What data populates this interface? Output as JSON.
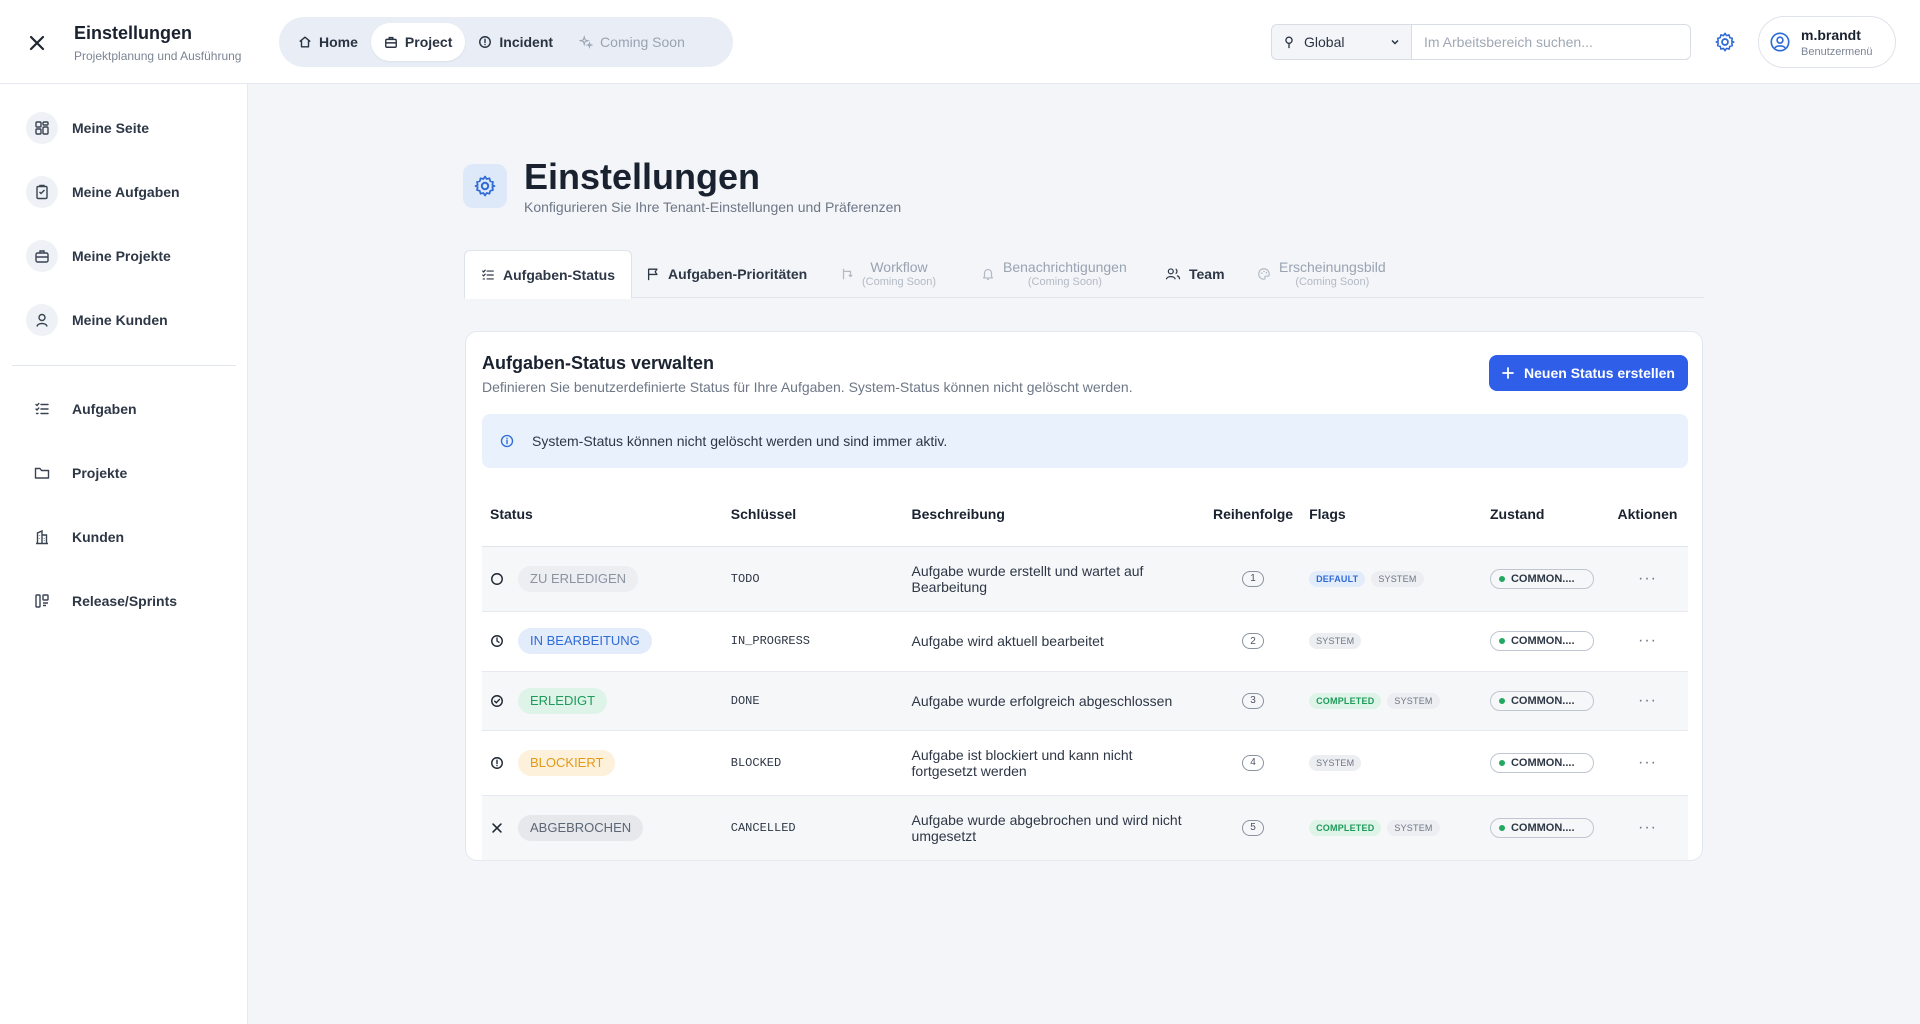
{
  "header": {
    "title": "Einstellungen",
    "subtitle": "Projektplanung und Ausführung",
    "nav": [
      {
        "label": "Home",
        "icon": "home-icon"
      },
      {
        "label": "Project",
        "icon": "briefcase-icon",
        "active": true
      },
      {
        "label": "Incident",
        "icon": "alert-circle-icon"
      },
      {
        "label": "Coming Soon",
        "icon": "sparkles-icon",
        "disabled": true
      }
    ],
    "scope_label": "Global",
    "search_placeholder": "Im Arbeitsbereich suchen...",
    "user_name": "m.brandt",
    "user_sub": "Benutzermenü"
  },
  "sidebar": {
    "items": [
      {
        "label": "Meine Seite",
        "icon": "dashboard-icon"
      },
      {
        "label": "Meine Aufgaben",
        "icon": "clipboard-icon"
      },
      {
        "label": "Meine Projekte",
        "icon": "briefcase-icon"
      },
      {
        "label": "Meine Kunden",
        "icon": "user-icon"
      },
      {
        "label": "Aufgaben",
        "icon": "list-check-icon"
      },
      {
        "label": "Projekte",
        "icon": "folder-icon"
      },
      {
        "label": "Kunden",
        "icon": "building-icon"
      },
      {
        "label": "Release/Sprints",
        "icon": "kanban-icon"
      }
    ]
  },
  "page": {
    "title": "Einstellungen",
    "subtitle": "Konfigurieren Sie Ihre Tenant-Einstellungen und Präferenzen"
  },
  "tabs": [
    {
      "label": "Aufgaben-Status",
      "active": true
    },
    {
      "label": "Aufgaben-Prioritäten"
    },
    {
      "label": "Workflow",
      "soon": "(Coming Soon)"
    },
    {
      "label": "Benachrichtigungen",
      "soon": "(Coming Soon)"
    },
    {
      "label": "Team"
    },
    {
      "label": "Erscheinungsbild",
      "soon": "(Coming Soon)"
    }
  ],
  "card": {
    "title": "Aufgaben-Status verwalten",
    "subtitle": "Definieren Sie benutzerdefinierte Status für Ihre Aufgaben. System-Status können nicht gelöscht werden.",
    "create_button": "Neuen Status erstellen",
    "info": "System-Status können nicht gelöscht werden und sind immer aktiv."
  },
  "table": {
    "headers": [
      "Status",
      "Schlüssel",
      "Beschreibung",
      "Reihenfolge",
      "Flags",
      "Zustand",
      "Aktionen"
    ],
    "rows": [
      {
        "status": "ZU ERLEDIGEN",
        "key": "TODO",
        "description": "Aufgabe wurde erstellt und wartet auf Bearbeitung",
        "order": "1",
        "flag1": "DEFAULT",
        "flag2": "SYSTEM",
        "state": "COMMON...."
      },
      {
        "status": "IN BEARBEITUNG",
        "key": "IN_PROGRESS",
        "description": "Aufgabe wird aktuell bearbeitet",
        "order": "2",
        "flag1": "SYSTEM",
        "state": "COMMON...."
      },
      {
        "status": "ERLEDIGT",
        "key": "DONE",
        "description": "Aufgabe wurde erfolgreich abgeschlossen",
        "order": "3",
        "flag1": "COMPLETED",
        "flag2": "SYSTEM",
        "state": "COMMON...."
      },
      {
        "status": "BLOCKIERT",
        "key": "BLOCKED",
        "description": "Aufgabe ist blockiert und kann nicht fortgesetzt werden",
        "order": "4",
        "flag1": "SYSTEM",
        "state": "COMMON...."
      },
      {
        "status": "ABGEBROCHEN",
        "key": "CANCELLED",
        "description": "Aufgabe wurde abgebrochen und wird nicht umgesetzt",
        "order": "5",
        "flag1": "COMPLETED",
        "flag2": "SYSTEM",
        "state": "COMMON...."
      }
    ],
    "actions_glyph": "···"
  },
  "colors": {
    "accent": "#2f5fe8",
    "info_bg": "#e8f1fc",
    "state_active": "#22a861"
  }
}
